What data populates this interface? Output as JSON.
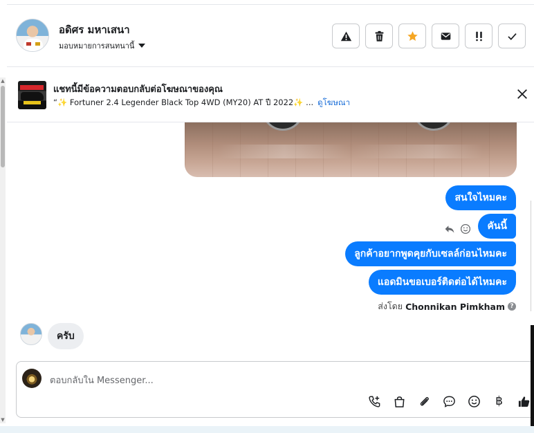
{
  "header": {
    "contact_name": "อดิศร มหาเสนา",
    "assign_label": "มอบหมายการสนทนานี้",
    "actions": [
      {
        "name": "report-spam-button",
        "icon": "warning-icon"
      },
      {
        "name": "delete-button",
        "icon": "trash-icon"
      },
      {
        "name": "star-button",
        "icon": "star-icon"
      },
      {
        "name": "mark-unread-button",
        "icon": "envelope-icon"
      },
      {
        "name": "follow-up-button",
        "icon": "double-exclamation-icon"
      },
      {
        "name": "mark-done-button",
        "icon": "check-icon"
      }
    ],
    "star_color": "#f5a623"
  },
  "ad_banner": {
    "title": "แชทนี้มีข้อความตอบกลับต่อโฆษณาของคุณ",
    "ad_text": "“✨ Fortuner 2.4 Legender Black Top 4WD (MY20) AT ปี 2022✨ ...",
    "view_ad_label": "ดูโฆษณา"
  },
  "messages": {
    "outgoing": [
      "สนใจไหมคะ",
      "คันนี้",
      "ลูกค้าอยากพูดคุยกับเซลล์ก่อนไหมคะ",
      "แอดมินขอเบอร์ติดต่อได้ไหมคะ"
    ],
    "sent_by_prefix": "ส่งโดย",
    "sent_by_name": "Chonnikan Pimkham",
    "help_glyph": "?",
    "incoming": [
      "ครับ"
    ]
  },
  "composer": {
    "placeholder": "ตอบกลับใน Messenger...",
    "currency_glyph": "฿"
  },
  "colors": {
    "outgoing_bubble": "#0a7cff",
    "incoming_bubble": "#eceef1",
    "link": "#1a6ed8"
  }
}
